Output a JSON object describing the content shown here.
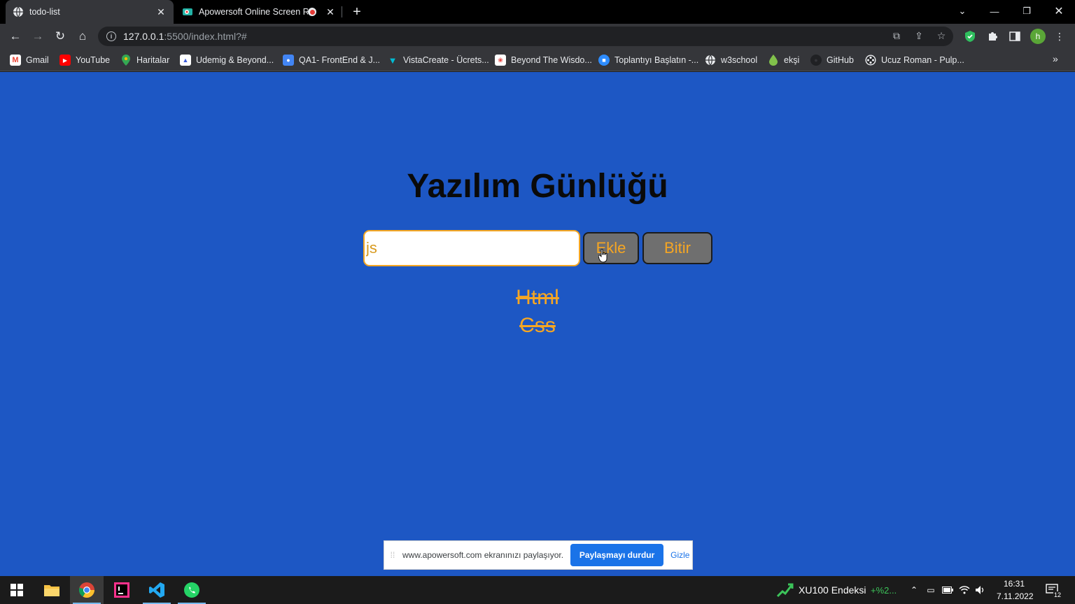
{
  "browser": {
    "tabs": [
      {
        "title": "todo-list",
        "active": true
      },
      {
        "title": "Apowersoft Online Screen Re",
        "active": false
      }
    ],
    "address": {
      "host": "127.0.0.1",
      "rest": ":5500/index.html?#"
    },
    "avatar_initial": "h",
    "bookmarks": [
      {
        "label": "Gmail",
        "icon": "gmail-icon",
        "color": "#ea4335"
      },
      {
        "label": "YouTube",
        "icon": "youtube-icon",
        "color": "#ff0000"
      },
      {
        "label": "Haritalar",
        "icon": "maps-pin-icon",
        "color": "#34a853"
      },
      {
        "label": "Udemig & Beyond...",
        "icon": "udemig-icon",
        "color": "#ffffff"
      },
      {
        "label": "QA1- FrontEnd & J...",
        "icon": "classroom-icon",
        "color": "#4285f4"
      },
      {
        "label": "VistaCreate - Ücrets...",
        "icon": "vistacreate-icon",
        "color": "#00bcd4"
      },
      {
        "label": "Beyond The Wisdo...",
        "icon": "beyond-icon",
        "color": "#ffffff"
      },
      {
        "label": "Toplantıyı Başlatın -...",
        "icon": "zoom-icon",
        "color": "#2d8cff"
      },
      {
        "label": "w3school",
        "icon": "globe-icon",
        "color": "#e8eaed"
      },
      {
        "label": "ekşi",
        "icon": "eksi-drop-icon",
        "color": "#81c14b"
      },
      {
        "label": "GitHub",
        "icon": "github-icon",
        "color": "#202124"
      },
      {
        "label": "Ucuz Roman - Pulp...",
        "icon": "film-reel-icon",
        "color": "#202124"
      }
    ]
  },
  "app": {
    "title": "Yazılım Günlüğü",
    "input_value": "js",
    "add_label": "Ekle",
    "finish_label": "Bitir",
    "items": [
      {
        "text": "Html",
        "done": true
      },
      {
        "text": "Css",
        "done": true
      }
    ],
    "colors": {
      "background": "#1d57c4",
      "accent": "#f6a623",
      "button": "#6f6f6f"
    }
  },
  "share_banner": {
    "message": "www.apowersoft.com ekranınızı paylaşıyor.",
    "stop_label": "Paylaşmayı durdur",
    "hide_label": "Gizle"
  },
  "taskbar": {
    "apps": [
      "start-icon",
      "file-explorer-icon",
      "chrome-icon",
      "intellij-icon",
      "vscode-icon",
      "whatsapp-icon"
    ],
    "stock": {
      "name": "XU100 Endeksi",
      "change": "+%2..."
    },
    "time": "16:31",
    "date": "7.11.2022",
    "notifications": "12"
  }
}
